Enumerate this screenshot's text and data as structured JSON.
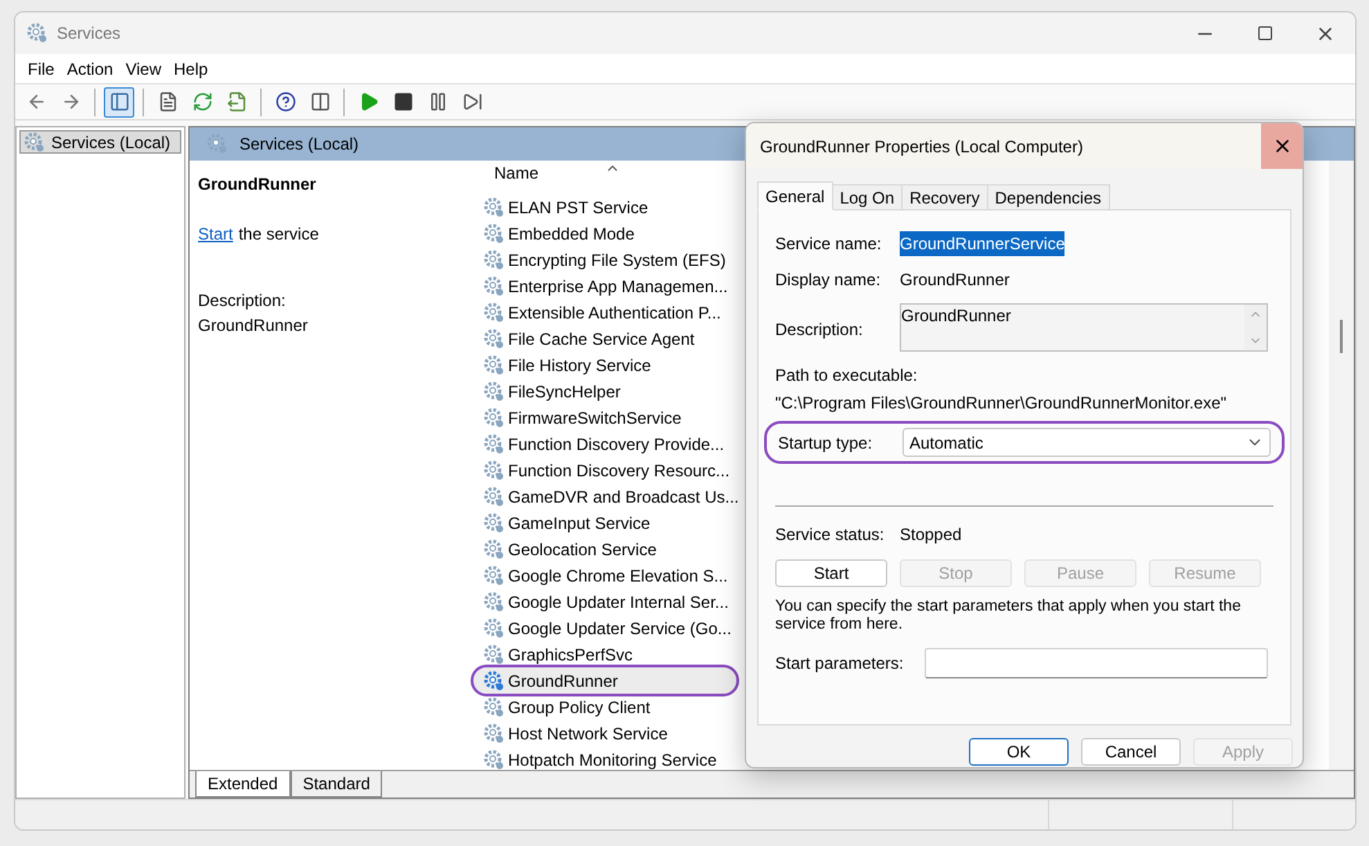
{
  "window": {
    "title": "Services"
  },
  "menu": [
    "File",
    "Action",
    "View",
    "Help"
  ],
  "toolbar": [
    {
      "pressed": false
    },
    {
      "pressed": false
    },
    {
      "pressed": true
    },
    {
      "pressed": false
    },
    {
      "pressed": false
    },
    {
      "pressed": false
    },
    {
      "pressed": false
    },
    {
      "pressed": false
    },
    {
      "pressed": false
    },
    {
      "pressed": false
    },
    {
      "pressed": false
    },
    {
      "pressed": false
    }
  ],
  "tree": [
    {
      "label": "Services (Local)",
      "selected": true
    }
  ],
  "pane": {
    "title": "Services (Local)",
    "service_title": "GroundRunner",
    "action_link": "Start",
    "action_rest": "the service",
    "description_label": "Description:",
    "description": "GroundRunner"
  },
  "table": {
    "columns": [
      "Name"
    ],
    "rows": [
      {
        "name": "ELAN PST Service",
        "selected": false,
        "circled": false
      },
      {
        "name": "Embedded Mode",
        "selected": false,
        "circled": false
      },
      {
        "name": "Encrypting File System (EFS)",
        "selected": false,
        "circled": false
      },
      {
        "name": "Enterprise App Managemen...",
        "selected": false,
        "circled": false
      },
      {
        "name": "Extensible Authentication P...",
        "selected": false,
        "circled": false
      },
      {
        "name": "File Cache Service Agent",
        "selected": false,
        "circled": false
      },
      {
        "name": "File History Service",
        "selected": false,
        "circled": false
      },
      {
        "name": "FileSyncHelper",
        "selected": false,
        "circled": false
      },
      {
        "name": "FirmwareSwitchService",
        "selected": false,
        "circled": false
      },
      {
        "name": "Function Discovery Provide...",
        "selected": false,
        "circled": false
      },
      {
        "name": "Function Discovery Resourc...",
        "selected": false,
        "circled": false
      },
      {
        "name": "GameDVR and Broadcast Us...",
        "selected": false,
        "circled": false
      },
      {
        "name": "GameInput Service",
        "selected": false,
        "circled": false
      },
      {
        "name": "Geolocation Service",
        "selected": false,
        "circled": false
      },
      {
        "name": "Google Chrome Elevation S...",
        "selected": false,
        "circled": false
      },
      {
        "name": "Google Updater Internal Ser...",
        "selected": false,
        "circled": false
      },
      {
        "name": "Google Updater Service (Go...",
        "selected": false,
        "circled": false
      },
      {
        "name": "GraphicsPerfSvc",
        "selected": false,
        "circled": false
      },
      {
        "name": "GroundRunner",
        "selected": true,
        "circled": true
      },
      {
        "name": "Group Policy Client",
        "selected": false,
        "circled": false
      },
      {
        "name": "Host Network Service",
        "selected": false,
        "circled": false
      },
      {
        "name": "Hotpatch Monitoring Service",
        "selected": false,
        "circled": false
      }
    ]
  },
  "view_tabs": [
    {
      "label": "Extended",
      "selected": true
    },
    {
      "label": "Standard",
      "selected": false
    }
  ],
  "dialog": {
    "title": "GroundRunner Properties (Local Computer)",
    "tabs": [
      {
        "label": "General",
        "selected": true
      },
      {
        "label": "Log On",
        "selected": false
      },
      {
        "label": "Recovery",
        "selected": false
      },
      {
        "label": "Dependencies",
        "selected": false
      }
    ],
    "service_name_label": "Service name:",
    "service_name": "GroundRunnerService",
    "display_name_label": "Display name:",
    "display_name": "GroundRunner",
    "description_label": "Description:",
    "description": "GroundRunner",
    "path_label": "Path to executable:",
    "path": "\"C:\\Program Files\\GroundRunner\\GroundRunnerMonitor.exe\"",
    "startup_label": "Startup type:",
    "startup_value": "Automatic",
    "startup_circled": true,
    "status_label": "Service status:",
    "status": "Stopped",
    "control_buttons": [
      {
        "label": "Start",
        "disabled": false
      },
      {
        "label": "Stop",
        "disabled": true
      },
      {
        "label": "Pause",
        "disabled": true
      },
      {
        "label": "Resume",
        "disabled": true
      }
    ],
    "hint": "You can specify the start parameters that apply when you start the service from here.",
    "params_label": "Start parameters:",
    "buttons": [
      {
        "label": "OK",
        "disabled": false,
        "default": true
      },
      {
        "label": "Cancel",
        "disabled": false,
        "default": false
      },
      {
        "label": "Apply",
        "disabled": true,
        "default": false
      }
    ]
  }
}
